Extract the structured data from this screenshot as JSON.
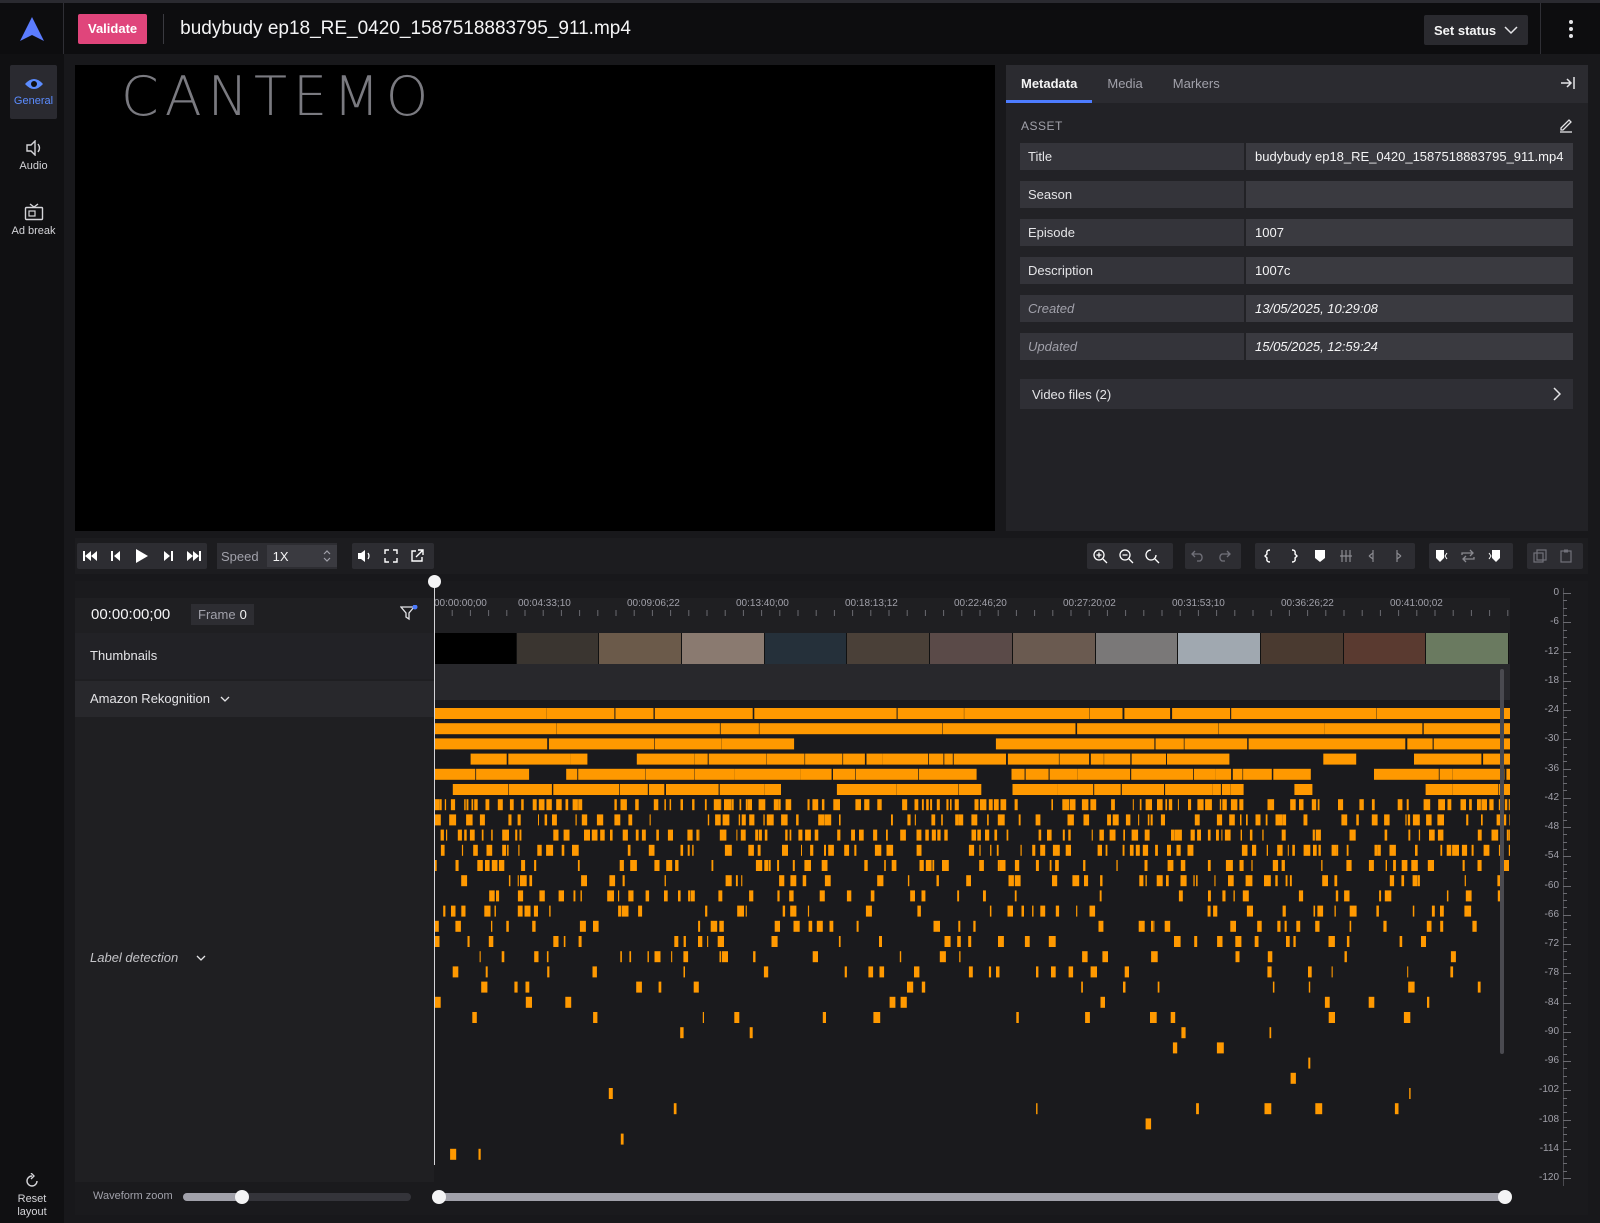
{
  "header": {
    "validate_label": "Validate",
    "filename": "budybudy ep18_RE_0420_1587518883795_911.mp4",
    "set_status_label": "Set status"
  },
  "rail": {
    "items": [
      {
        "label": "General",
        "icon": "eye-icon"
      },
      {
        "label": "Audio",
        "icon": "speaker-icon"
      },
      {
        "label": "Ad break",
        "icon": "tv-icon"
      }
    ],
    "reset_label_1": "Reset",
    "reset_label_2": "layout"
  },
  "player": {
    "watermark": "CANTEMO",
    "speed_label": "Speed",
    "speed_value": "1X"
  },
  "panel": {
    "tabs": [
      "Metadata",
      "Media",
      "Markers"
    ],
    "section": "ASSET",
    "fields": [
      {
        "key": "Title",
        "value": "budybudy ep18_RE_0420_1587518883795_911.mp4"
      },
      {
        "key": "Season",
        "value": ""
      },
      {
        "key": "Episode",
        "value": "1007"
      },
      {
        "key": "Description",
        "value": "1007c"
      },
      {
        "key": "Created",
        "value": "13/05/2025, 10:29:08"
      },
      {
        "key": "Updated",
        "value": "15/05/2025, 12:59:24"
      }
    ],
    "video_files_label": "Video files (2)"
  },
  "timeline": {
    "timecode_main": "00:00:00;",
    "timecode_frames": "00",
    "frame_label": "Frame",
    "frame_value": "0",
    "ruler": [
      "00:00:00;00",
      "00:04:33;10",
      "00:09:06;22",
      "00:13:40;00",
      "00:18:13;12",
      "00:22:46;20",
      "00:27:20;02",
      "00:31:53;10",
      "00:36:26;22",
      "00:41:00;02"
    ],
    "tracks": {
      "thumbnails": "Thumbnails",
      "rekognition": "Amazon Rekognition",
      "label_detection": "Label detection"
    },
    "db_scale": [
      "0",
      "-6",
      "-12",
      "-18",
      "-24",
      "-30",
      "-36",
      "-42",
      "-48",
      "-54",
      "-60",
      "-66",
      "-72",
      "-78",
      "-84",
      "-90",
      "-96",
      "-102",
      "-108",
      "-114",
      "-120"
    ],
    "waveform_zoom_label": "Waveform zoom",
    "waveform_zoom": 0.26,
    "label_color": "#ff9900"
  },
  "colors": {
    "accent": "#4d7cff",
    "validate": "#e0457b"
  }
}
